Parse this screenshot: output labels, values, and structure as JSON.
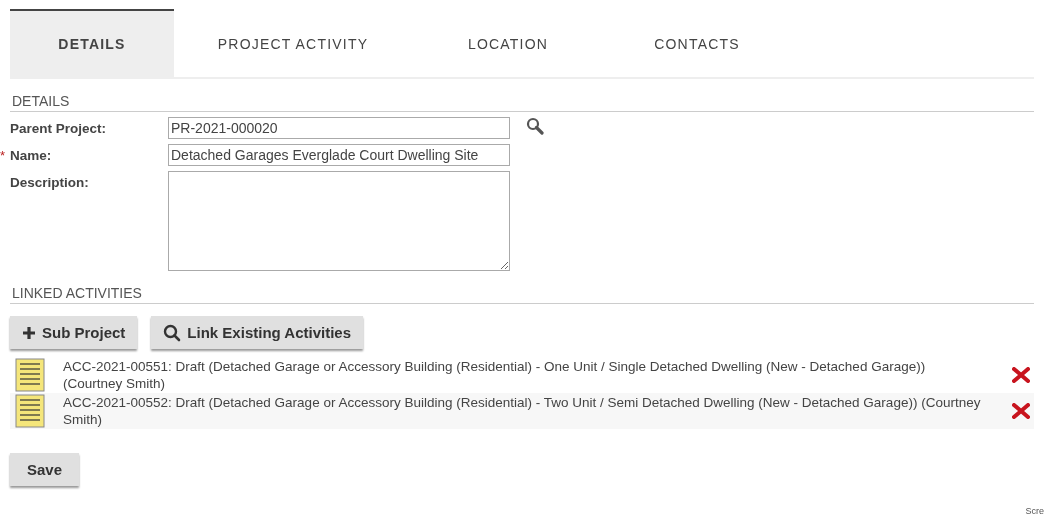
{
  "tabs": [
    {
      "label": "DETAILS",
      "selected": true
    },
    {
      "label": "PROJECT ACTIVITY",
      "selected": false
    },
    {
      "label": "LOCATION",
      "selected": false
    },
    {
      "label": "CONTACTS",
      "selected": false
    }
  ],
  "details": {
    "heading": "DETAILS",
    "fields": [
      {
        "kind": "lookup",
        "label": "Parent Project:",
        "value": "PR-2021-000020"
      },
      {
        "kind": "text",
        "label": "Name:",
        "value": "Detached Garages Everglade Court Dwelling Site",
        "marker": "*"
      },
      {
        "kind": "textarea",
        "label": "Description:"
      }
    ]
  },
  "linked_activities": {
    "heading": "LINKED ACTIVITIES",
    "buttons": [
      {
        "kind": "add",
        "label": "Sub Project"
      },
      {
        "kind": "search",
        "label": "Link Existing Activities"
      }
    ],
    "items": [
      {
        "text": "ACC-2021-00551: Draft (Detached Garage or Accessory Building (Residential) - One Unit / Single Detached Dwelling (New - Detached Garage)) (Courtney Smith)"
      },
      {
        "text": "ACC-2021-00552: Draft (Detached Garage or Accessory Building (Residential) - Two Unit / Semi Detached Dwelling (New - Detached Garage)) (Courtney Smith)"
      }
    ]
  },
  "save_button": "Save",
  "corner_text": "Scre"
}
